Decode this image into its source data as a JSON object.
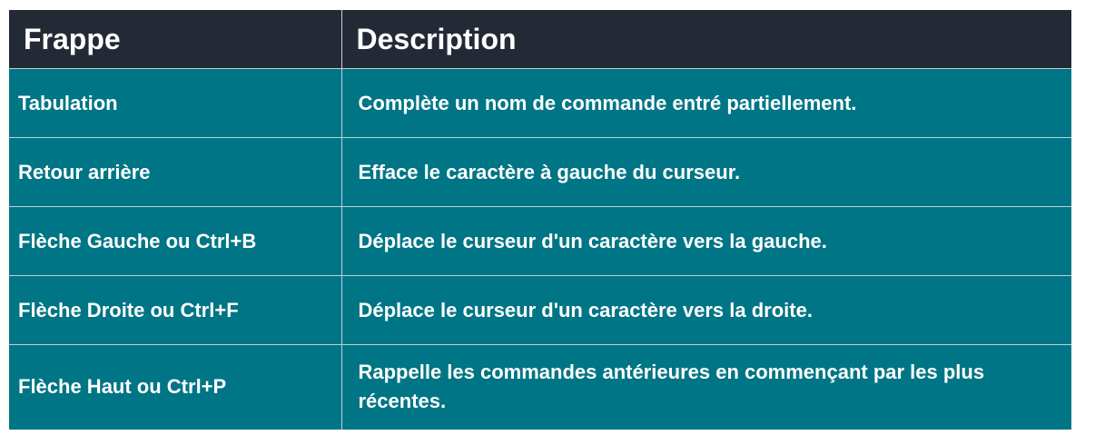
{
  "table": {
    "headers": [
      "Frappe",
      "Description"
    ],
    "rows": [
      {
        "key": "Tabulation",
        "description": "Complète un nom de commande entré partiellement."
      },
      {
        "key": "Retour arrière",
        "description": "Efface le caractère à gauche du curseur."
      },
      {
        "key": "Flèche Gauche ou Ctrl+B",
        "description": "Déplace le curseur d'un caractère vers la gauche."
      },
      {
        "key": "Flèche Droite ou Ctrl+F",
        "description": "Déplace le curseur d'un caractère vers la droite."
      },
      {
        "key": "Flèche Haut ou Ctrl+P",
        "description": "Rappelle les commandes antérieures en commençant par les plus récentes."
      }
    ],
    "colors": {
      "header_bg": "#232a35",
      "row_bg": "#007585",
      "text": "#ffffff"
    }
  }
}
